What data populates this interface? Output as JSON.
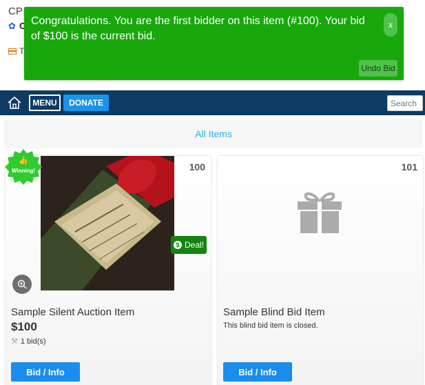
{
  "top": {
    "cp_text": "CP",
    "gear_text": "C",
    "card_text": "T"
  },
  "notification": {
    "message": "Congratulations. You are the first bidder on this item (#100). Your bid of $100 is the current bid.",
    "close_label": "x",
    "undo_label": "Undo Bid",
    "color": "#18a80b"
  },
  "navbar": {
    "menu_label": "MENU",
    "donate_label": "DONATE",
    "search_placeholder": "Search",
    "home_icon": "home-icon",
    "background": "#0d3b63"
  },
  "all_items_label": "All Items",
  "items": [
    {
      "number": "100",
      "title": "Sample Silent Auction Item",
      "price": "$100",
      "bids": "1 bid(s)",
      "badge_winning": "Winning!",
      "badge_deal": "Deal!",
      "button": "Bid / Info"
    },
    {
      "number": "101",
      "title": "Sample Blind Bid Item",
      "status": "This blind bid item is closed.",
      "button": "Bid / Info",
      "image_icon": "gift-icon"
    }
  ]
}
